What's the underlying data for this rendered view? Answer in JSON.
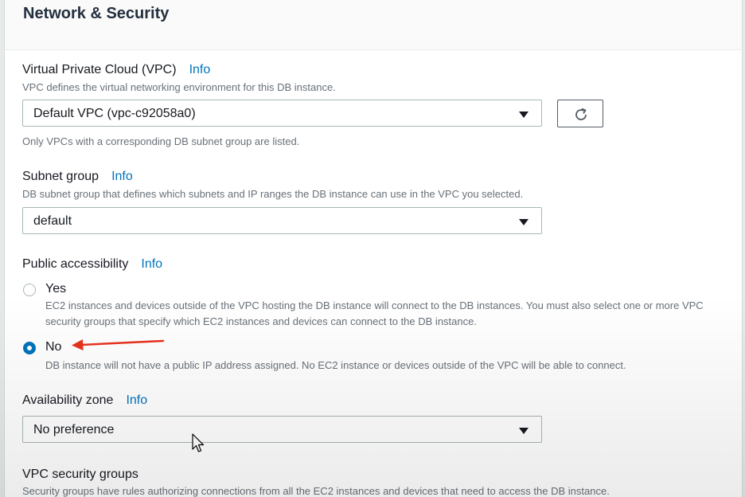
{
  "section": {
    "title": "Network & Security"
  },
  "vpc": {
    "label": "Virtual Private Cloud (VPC)",
    "info": "Info",
    "description": "VPC defines the virtual networking environment for this DB instance.",
    "selected": "Default VPC (vpc-c92058a0)",
    "hint": "Only VPCs with a corresponding DB subnet group are listed.",
    "refresh_icon": "refresh-icon"
  },
  "subnet_group": {
    "label": "Subnet group",
    "info": "Info",
    "description": "DB subnet group that defines which subnets and IP ranges the DB instance can use in the VPC you selected.",
    "selected": "default"
  },
  "public_accessibility": {
    "label": "Public accessibility",
    "info": "Info",
    "options": [
      {
        "label": "Yes",
        "checked": false,
        "description": "EC2 instances and devices outside of the VPC hosting the DB instance will connect to the DB instances. You must also select one or more VPC security groups that specify which EC2 instances and devices can connect to the DB instance."
      },
      {
        "label": "No",
        "checked": true,
        "description": "DB instance will not have a public IP address assigned. No EC2 instance or devices outside of the VPC will be able to connect."
      }
    ]
  },
  "availability_zone": {
    "label": "Availability zone",
    "info": "Info",
    "selected": "No preference"
  },
  "vpc_security_groups": {
    "label": "VPC security groups",
    "description": "Security groups have rules authorizing connections from all the EC2 instances and devices that need to access the DB instance."
  },
  "colors": {
    "info_link": "#0073bb",
    "radio_selected": "#0073bb",
    "annotation_arrow": "#e8321e"
  }
}
